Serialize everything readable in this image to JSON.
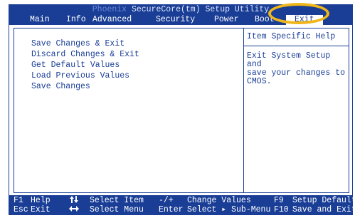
{
  "header": {
    "title_brand": "Phoenix",
    "title_rest": " SecureCore(tm) Setup Utility"
  },
  "menu": [
    {
      "label": "Main"
    },
    {
      "label": "Info"
    },
    {
      "label": "Advanced"
    },
    {
      "label": "Security"
    },
    {
      "label": "Power"
    },
    {
      "label": "Boot"
    },
    {
      "label": "Exit",
      "active": true
    }
  ],
  "options": [
    "Save Changes & Exit",
    "Discard Changes & Exit",
    "Get Default Values",
    "Load Previous Values",
    "Save Changes"
  ],
  "help": {
    "title": "Item Specific Help",
    "text": "Exit System Setup and\nsave your changes to\nCMOS."
  },
  "footer": {
    "row1": [
      {
        "key": "F1",
        "label": "Help"
      },
      {
        "key": "arrows-updown",
        "label": "Select Item"
      },
      {
        "key": "-/+",
        "label": "Change Values"
      },
      {
        "key": "F9",
        "label": "Setup Defaults"
      }
    ],
    "row2": [
      {
        "key": "Esc",
        "label": "Exit"
      },
      {
        "key": "arrows-leftright",
        "label": "Select Menu"
      },
      {
        "key": "Enter",
        "label": "Select ▸ Sub-Menu"
      },
      {
        "key": "F10",
        "label": "Save and Exit"
      }
    ]
  },
  "colors": {
    "bios_blue": "#1a3e96",
    "highlight_ring": "#f0b71a",
    "background": "#ffffff"
  }
}
